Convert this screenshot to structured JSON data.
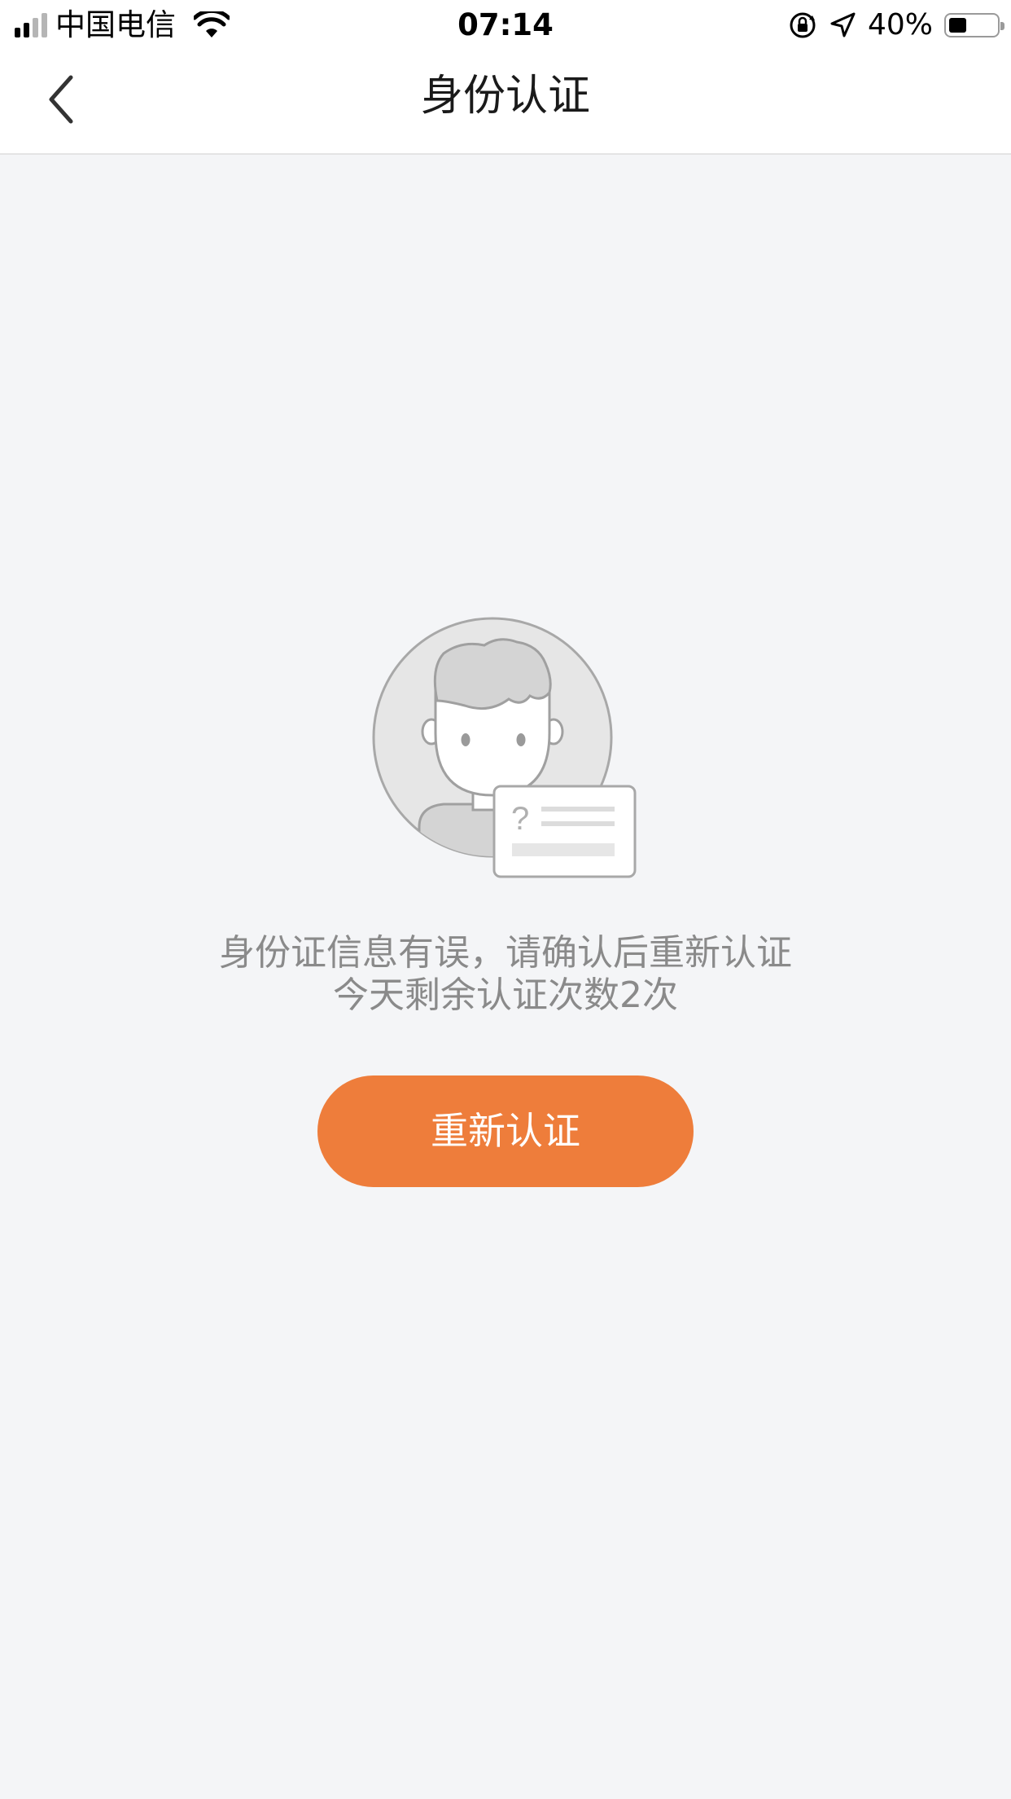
{
  "status_bar": {
    "carrier": "中国电信",
    "time": "07:14",
    "battery_percent": "40%",
    "battery_level": 0.4,
    "icons": [
      "signal-icon",
      "wifi-icon",
      "orientation-lock-icon",
      "location-arrow-icon",
      "battery-icon"
    ]
  },
  "nav": {
    "title": "身份认证",
    "back_icon": "chevron-left-icon"
  },
  "illustration": {
    "icon": "id-verification-person-icon",
    "card_symbol": "?"
  },
  "message": {
    "line1": "身份证信息有误，请确认后重新认证",
    "line2": "今天剩余认证次数2次"
  },
  "button": {
    "label": "重新认证"
  },
  "colors": {
    "accent": "#ee7d3b",
    "background": "#f4f5f7",
    "text_secondary": "#8a8a8a",
    "title": "#1a1a1a"
  }
}
